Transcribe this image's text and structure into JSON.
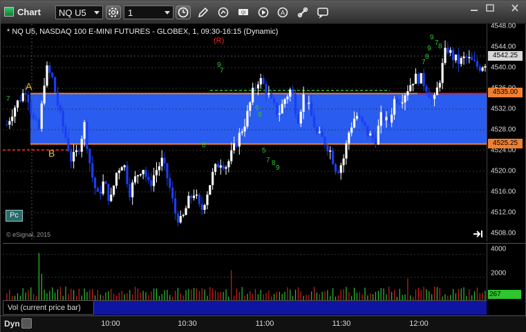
{
  "window": {
    "title": "Chart",
    "symbol": "NQ U5",
    "interval": "1"
  },
  "chart": {
    "title": "* NQ U5, NASDAQ 100 E-MINI FUTURES - GLOBEX, 1, 09:30-16:15 (Dynamic)",
    "r_marker": "(R)",
    "watermark": "© eSignal, 2015",
    "pc_button": "Pc",
    "marker_a": "A",
    "marker_b": "B",
    "green_annotations": [
      "7",
      "9",
      "7",
      "8",
      "5",
      "7",
      "8",
      "9",
      "6",
      "9",
      "7",
      "8",
      "9",
      "7",
      "8",
      "9"
    ]
  },
  "price_axis": {
    "ticks": [
      "4548.00",
      "4544.00",
      "4540.00",
      "4536.00",
      "4532.00",
      "4528.00",
      "4524.00",
      "4520.00",
      "4516.00",
      "4512.00",
      "4508.00"
    ],
    "last_price": "4542.25",
    "upper_level": "4535.00",
    "lower_level": "4525.25",
    "colors": {
      "last": "#d8d8d8",
      "upper": "#f08030",
      "lower": "#f08030",
      "zone": "#2a5cf0",
      "red_line": "#e02020"
    }
  },
  "volume": {
    "legend": "Vol (current price bar)",
    "ticks": [
      "4000",
      "2000"
    ],
    "last_volume": "267"
  },
  "time_axis": {
    "mode": "Dyn",
    "ticks": [
      "10:00",
      "10:30",
      "11:00",
      "11:30",
      "12:00"
    ]
  },
  "chart_data": {
    "type": "candlestick",
    "title": "NQ U5, NASDAQ 100 E-MINI FUTURES - GLOBEX, 1, 09:30-16:15 (Dynamic)",
    "ylim": [
      4506,
      4550
    ],
    "levels": {
      "upper": 4535.0,
      "lower": 4525.25,
      "last": 4542.25
    },
    "close_path": [
      4529,
      4532,
      4534,
      4536,
      4530,
      4528,
      4540,
      4538,
      4532,
      4527,
      4522,
      4524,
      4529,
      4520,
      4515,
      4518,
      4514,
      4520,
      4522,
      4516,
      4519,
      4521,
      4517,
      4520,
      4522,
      4518,
      4512,
      4510,
      4514,
      4516,
      4512,
      4516,
      4520,
      4522,
      4521,
      4524,
      4527,
      4530,
      4535,
      4538,
      4536,
      4533,
      4531,
      4534,
      4536,
      4530,
      4535,
      4531,
      4527,
      4526,
      4524,
      4520,
      4522,
      4528,
      4531,
      4529,
      4527,
      4526,
      4531,
      4529,
      4534,
      4534,
      4536,
      4538,
      4538,
      4536,
      4533,
      4538,
      4544,
      4542,
      4541,
      4542,
      4541,
      4540,
      4541
    ],
    "volume_spike": 4100,
    "volume_ylim": [
      0,
      4500
    ]
  }
}
